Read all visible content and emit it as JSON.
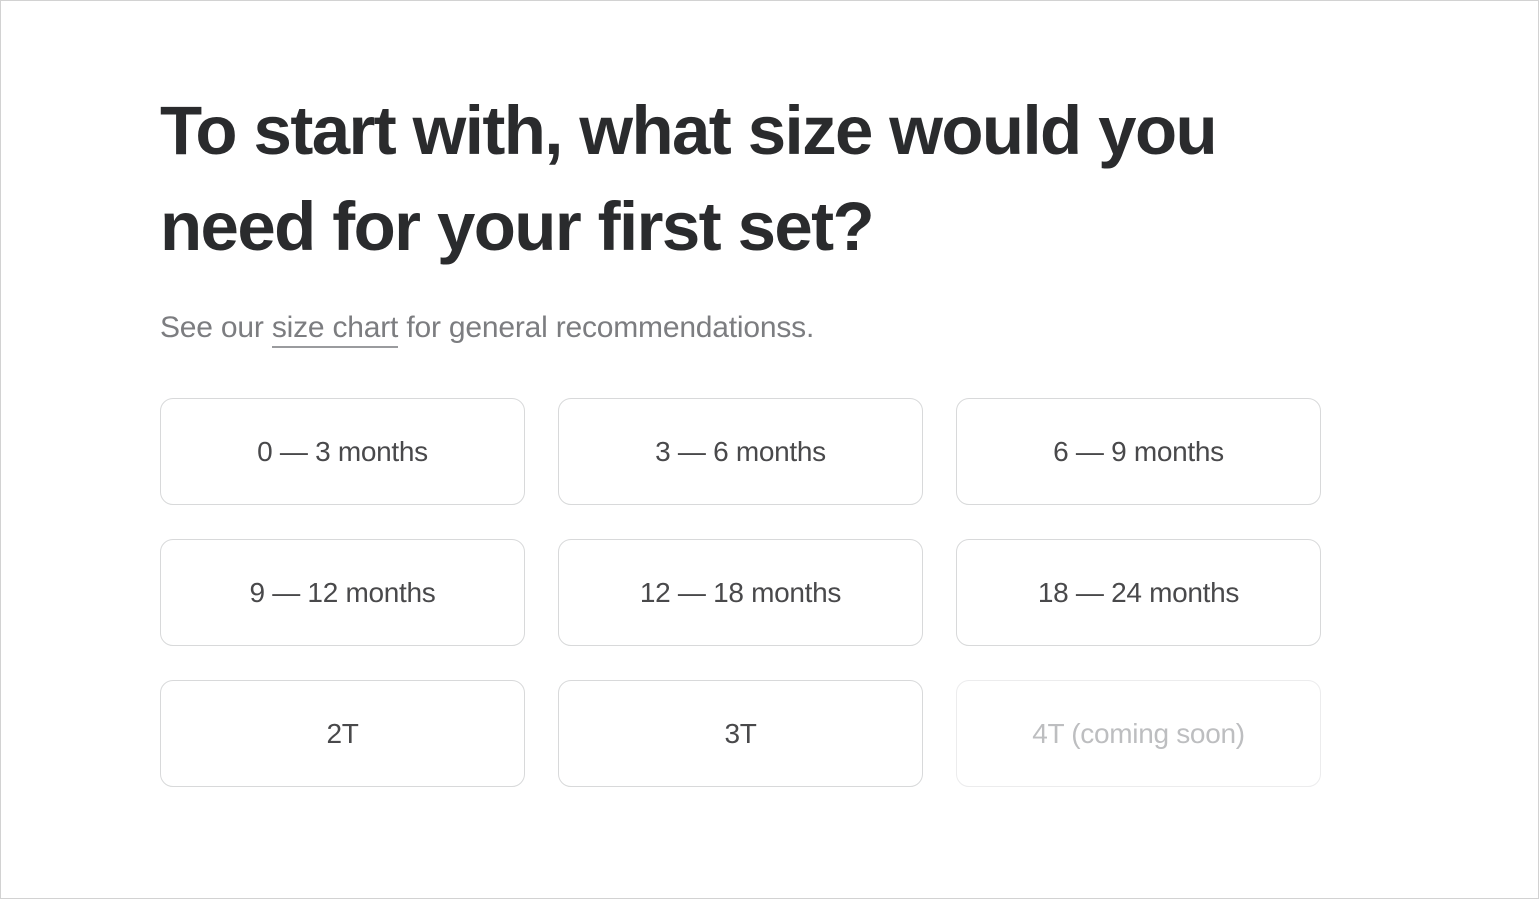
{
  "page": {
    "background_color": "#ffffff",
    "frame_border_color": "#d2d2d2"
  },
  "heading": {
    "title": "To start with, what size would you need for your first set?",
    "color": "#2a2b2d"
  },
  "subtitle": {
    "lead_text": "See our ",
    "link_text": "size chart",
    "trail_text": " for general recommendationss.",
    "color": "#7c7d80"
  },
  "size_grid": {
    "columns": 3,
    "border_color": "#d8d9da",
    "disabled_border_color": "#ececed",
    "label_color": "#49494b",
    "disabled_label_color": "#bdbec0",
    "options": [
      {
        "label": "0 — 3 months",
        "disabled": false
      },
      {
        "label": "3 — 6 months",
        "disabled": false
      },
      {
        "label": "6 — 9 months",
        "disabled": false
      },
      {
        "label": "9 — 12 months",
        "disabled": false
      },
      {
        "label": "12 — 18 months",
        "disabled": false
      },
      {
        "label": "18 — 24 months",
        "disabled": false
      },
      {
        "label": "2T",
        "disabled": false
      },
      {
        "label": "3T",
        "disabled": false
      },
      {
        "label": "4T (coming soon)",
        "disabled": true
      }
    ]
  }
}
